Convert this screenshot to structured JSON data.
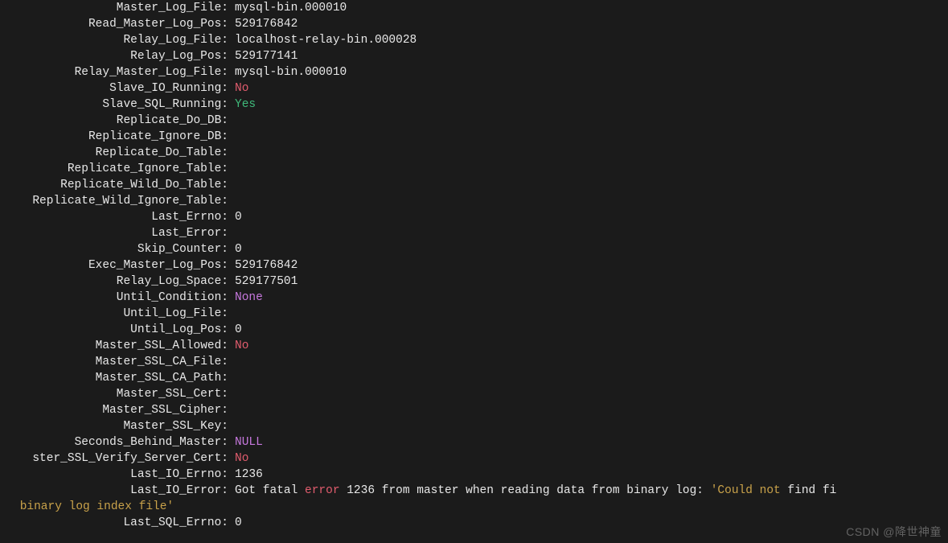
{
  "rows": [
    {
      "label": "Master_Log_File",
      "value": "mysql-bin.000010"
    },
    {
      "label": "Read_Master_Log_Pos",
      "value": "529176842"
    },
    {
      "label": "Relay_Log_File",
      "value": "localhost-relay-bin.000028"
    },
    {
      "label": "Relay_Log_Pos",
      "value": "529177141"
    },
    {
      "label": "Relay_Master_Log_File",
      "value": "mysql-bin.000010"
    },
    {
      "label": "Slave_IO_Running",
      "value": "No",
      "color": "red"
    },
    {
      "label": "Slave_SQL_Running",
      "value": "Yes",
      "color": "green"
    },
    {
      "label": "Replicate_Do_DB",
      "value": ""
    },
    {
      "label": "Replicate_Ignore_DB",
      "value": ""
    },
    {
      "label": "Replicate_Do_Table",
      "value": ""
    },
    {
      "label": "Replicate_Ignore_Table",
      "value": ""
    },
    {
      "label": "Replicate_Wild_Do_Table",
      "value": ""
    },
    {
      "label": "Replicate_Wild_Ignore_Table",
      "value": "",
      "truncated_left": true
    },
    {
      "label": "Last_Errno",
      "value": "0"
    },
    {
      "label": "Last_Error",
      "value": ""
    },
    {
      "label": "Skip_Counter",
      "value": "0"
    },
    {
      "label": "Exec_Master_Log_Pos",
      "value": "529176842"
    },
    {
      "label": "Relay_Log_Space",
      "value": "529177501"
    },
    {
      "label": "Until_Condition",
      "value": "None",
      "color": "magenta"
    },
    {
      "label": "Until_Log_File",
      "value": ""
    },
    {
      "label": "Until_Log_Pos",
      "value": "0"
    },
    {
      "label": "Master_SSL_Allowed",
      "value": "No",
      "color": "red"
    },
    {
      "label": "Master_SSL_CA_File",
      "value": ""
    },
    {
      "label": "Master_SSL_CA_Path",
      "value": ""
    },
    {
      "label": "Master_SSL_Cert",
      "value": ""
    },
    {
      "label": "Master_SSL_Cipher",
      "value": ""
    },
    {
      "label": "Master_SSL_Key",
      "value": ""
    },
    {
      "label": "Seconds_Behind_Master",
      "value": "NULL",
      "color": "magenta"
    },
    {
      "label": "ster_SSL_Verify_Server_Cert",
      "value": "No",
      "color": "red",
      "truncated_left": true
    },
    {
      "label": "Last_IO_Errno",
      "value": "1236"
    }
  ],
  "last_io_error": {
    "label": "Last_IO_Error",
    "pre": "Got fatal ",
    "err": "error",
    "mid": " 1236 from master when reading data from binary log: ",
    "q1": "'Could not",
    "tail": " find fi",
    "wrap": " binary log index file'"
  },
  "last_sql_errno": {
    "label": "Last_SQL_Errno",
    "value": "0"
  },
  "watermark": "CSDN @降世神童"
}
